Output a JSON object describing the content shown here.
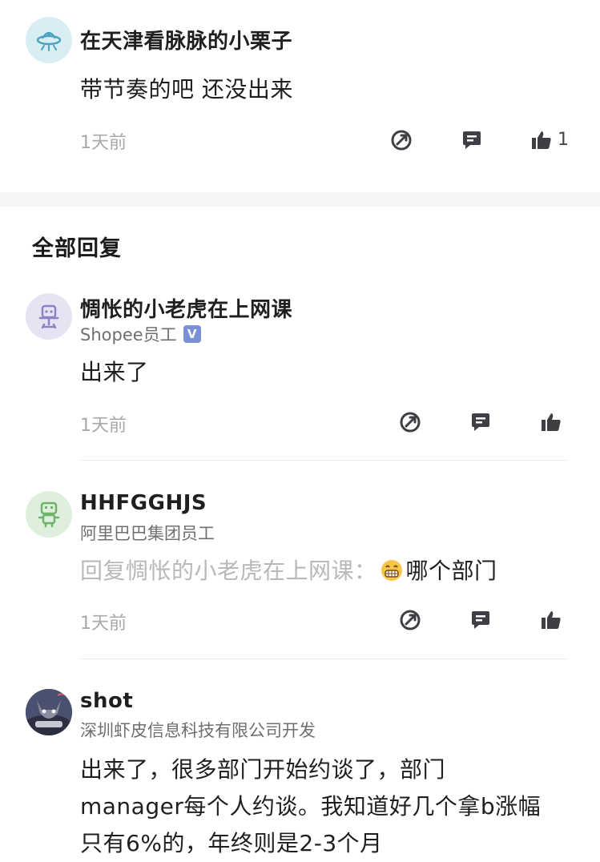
{
  "top_comment": {
    "username": "在天津看脉脉的小栗子",
    "content": "带节奏的吧 还没出来",
    "time": "1天前",
    "like_count": "1",
    "avatar_icon": "ufo-icon"
  },
  "section": {
    "title": "全部回复"
  },
  "replies": [
    {
      "username": "惆怅的小老虎在上网课",
      "company": "Shopee员工",
      "verified_badge": "V",
      "content": "出来了",
      "time": "1天前",
      "avatar_icon": "office-chair-icon"
    },
    {
      "username": "HHFGGHJS",
      "company": "阿里巴巴集团员工",
      "reply_prefix": "回复惆怅的小老虎在上网课：",
      "content": "哪个部门",
      "time": "1天前",
      "avatar_icon": "robot-icon"
    },
    {
      "username": "shot",
      "company": "深圳虾皮信息科技有限公司开发",
      "content_lines": [
        "出来了，很多部门开始约谈了，部门",
        "manager每个人约谈。我知道好几个拿b涨幅",
        "只有6%的，年终则是2-3个月"
      ],
      "avatar_icon": "cat-photo-avatar"
    }
  ],
  "colors": {
    "accent_badge": "#7b8fd6",
    "muted_text": "#a8a8a8",
    "icon_dark": "#3d3f45"
  }
}
